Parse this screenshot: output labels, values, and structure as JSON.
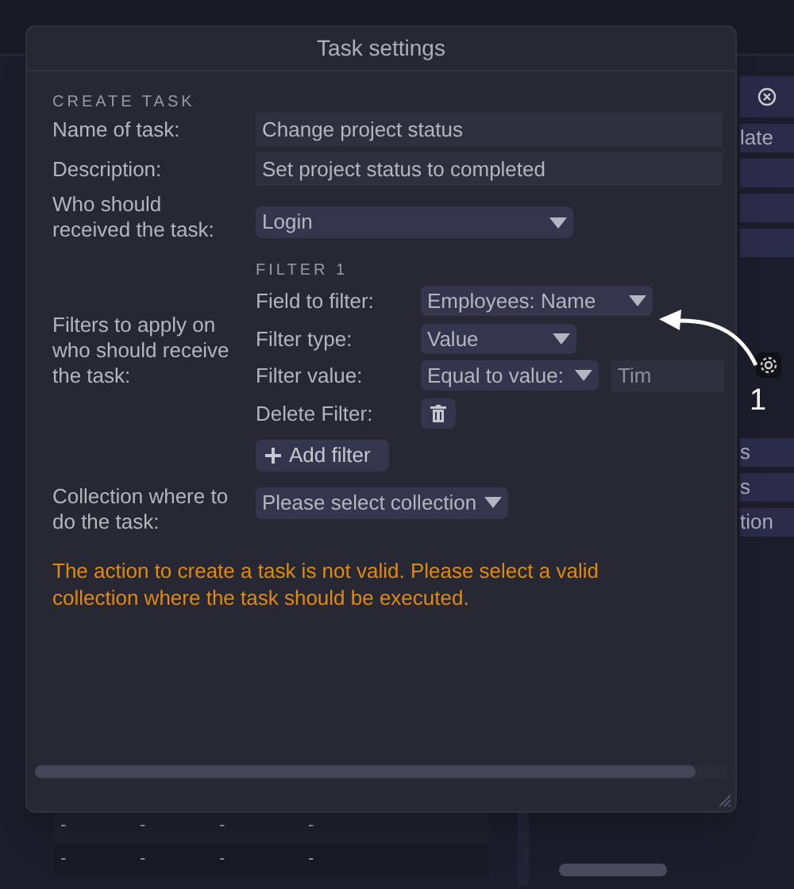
{
  "background": {
    "side_buttons": [
      {
        "kind": "text",
        "label": "late"
      },
      {
        "kind": "blank"
      },
      {
        "kind": "blank"
      },
      {
        "kind": "blank"
      }
    ],
    "lower_buttons": [
      {
        "label": "s"
      },
      {
        "label": "s"
      },
      {
        "label": "tion"
      }
    ],
    "table_rows": [
      [
        "-",
        "-",
        "-",
        "-"
      ],
      [
        "-",
        "-",
        "-",
        "-"
      ]
    ]
  },
  "dialog": {
    "title": "Task settings",
    "section_heading": "CREATE TASK",
    "name_label": "Name of task:",
    "name_value": "Change project status",
    "description_label": "Description:",
    "description_value": "Set project status to completed",
    "recipient_label": "Who should received the task:",
    "recipient_value": "Login",
    "filters_label": "Filters to apply on who should receive the task:",
    "filter": {
      "heading": "FILTER 1",
      "field_label": "Field to filter:",
      "field_value": "Employees: Name",
      "type_label": "Filter type:",
      "type_value": "Value",
      "value_label": "Filter value:",
      "operator_value": "Equal to value:",
      "value_text": "Tim",
      "delete_label": "Delete Filter:"
    },
    "add_filter_button": "Add filter",
    "collection_label": "Collection where to do the task:",
    "collection_placeholder": "Please select collection",
    "error_message": "The action to create a task is not valid. Please select a valid collection where the task should be executed."
  },
  "annotation": {
    "number": "1"
  }
}
